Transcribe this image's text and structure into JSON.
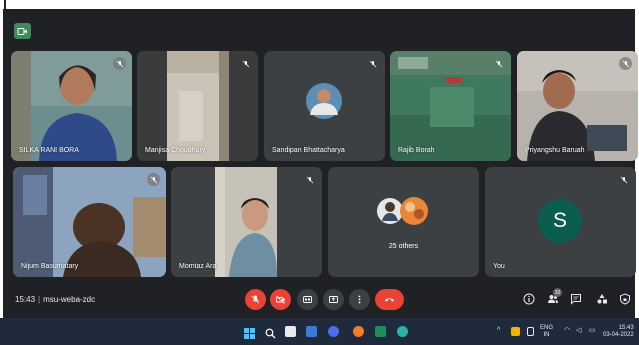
{
  "participants": [
    {
      "name": "SILKA RANI BORA"
    },
    {
      "name": "Manjisa Choudhury"
    },
    {
      "name": "Sandipan Bhattacharya"
    },
    {
      "name": "Rajib Borah"
    },
    {
      "name": "Priyangshu Baruah"
    },
    {
      "name": "Nijum Basumatary"
    },
    {
      "name": "Momtaz Ara"
    },
    {
      "name": "You",
      "initial": "S"
    }
  ],
  "others": {
    "label": "25 others"
  },
  "footer": {
    "time": "15:43",
    "separator": "|",
    "meeting_code": "msu-weba-zdc"
  },
  "people_count": "32",
  "tray": {
    "lang_top": "ENG",
    "lang_bottom": "IN",
    "time": "15:43",
    "date": "03-04-2022"
  },
  "colors": {
    "background": "#202124",
    "tile": "#3c4043",
    "leave": "#ea4335",
    "avatar": "#0b5e4f",
    "taskbar": "#1f2a3d"
  }
}
